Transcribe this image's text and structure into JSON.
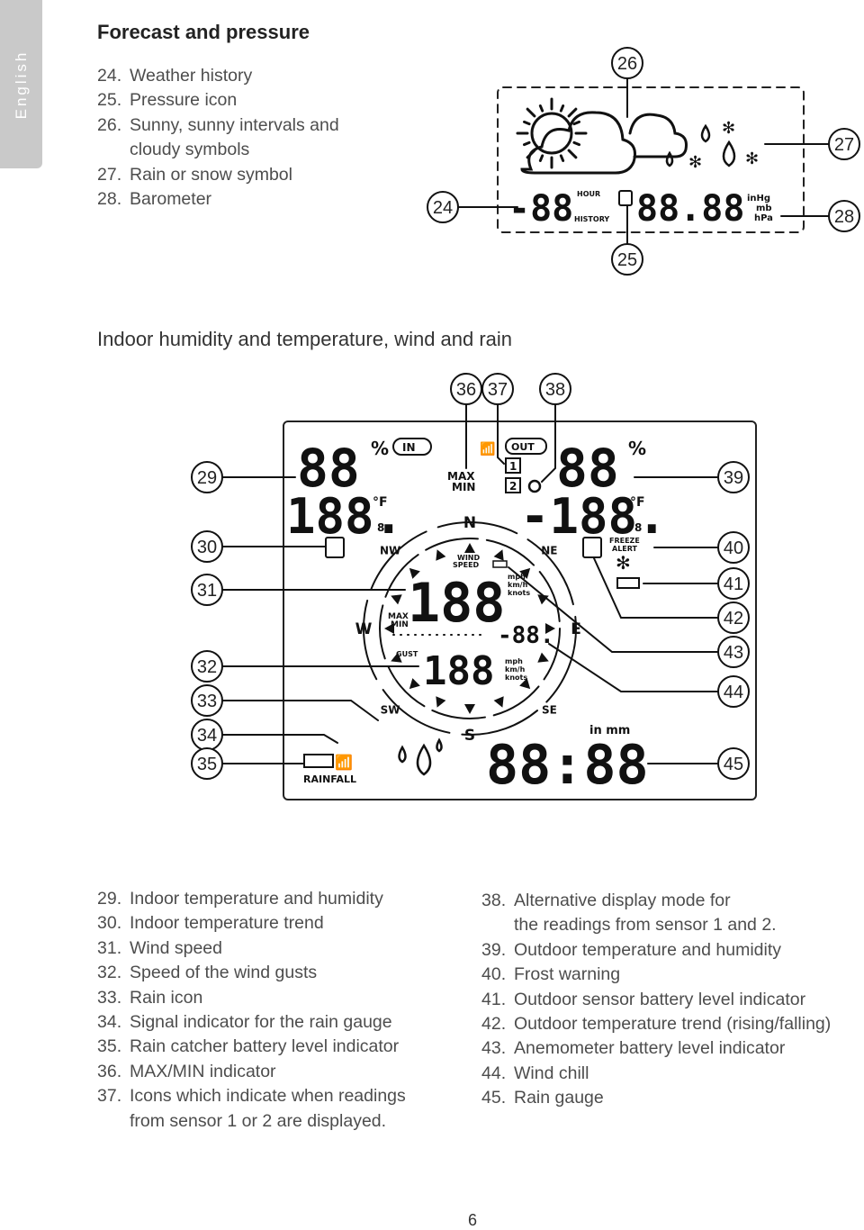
{
  "side_tab": {
    "label": "English"
  },
  "section1": {
    "title": "Forecast and pressure",
    "items": [
      {
        "num": "24.",
        "text": "Weather history"
      },
      {
        "num": "25.",
        "text": "Pressure icon"
      },
      {
        "num": "26.",
        "text": "Sunny, sunny intervals and",
        "cont": "cloudy symbols"
      },
      {
        "num": "27.",
        "text": "Rain or snow symbol"
      },
      {
        "num": "28.",
        "text": "Barometer"
      }
    ],
    "diagram": {
      "callouts": [
        "24",
        "25",
        "26",
        "27",
        "28"
      ],
      "history_digits": "-88",
      "hour": "HOUR",
      "history": "HISTORY",
      "pressure_digits": "88.88",
      "units": [
        "inHg",
        "mb",
        "hPa"
      ]
    }
  },
  "section2": {
    "title": "Indoor humidity and temperature, wind and rain",
    "diagram": {
      "callouts_left": [
        "29",
        "30",
        "31",
        "32",
        "33",
        "34",
        "35"
      ],
      "callouts_right": [
        "39",
        "40",
        "41",
        "42",
        "43",
        "44",
        "45"
      ],
      "callouts_top": [
        "36",
        "37",
        "38"
      ],
      "in_humidity": "88",
      "percent": "%",
      "in": "IN",
      "in_temp": "188.",
      "deg": "°F",
      "decimal": "8",
      "out": "OUT",
      "out_humidity": "88",
      "out_temp": "-188.",
      "max": "MAX",
      "min": "MIN",
      "sensor1": "1",
      "sensor2": "2",
      "compass": [
        "N",
        "NE",
        "E",
        "SE",
        "S",
        "SW",
        "W",
        "NW"
      ],
      "wind": "WIND",
      "speed": "SPEED",
      "wind_digits": "188",
      "gust": "GUST",
      "gust_digits": "188",
      "units": [
        "mph",
        "km/h",
        "knots"
      ],
      "chill_digits": "-88.",
      "freeze": "FREEZE",
      "alert": "ALERT",
      "rainfall": "RAINFALL",
      "rain_units": "in mm",
      "rain_digits": "88:88"
    }
  },
  "list_left": [
    {
      "num": "29.",
      "text": "Indoor temperature and humidity"
    },
    {
      "num": "30.",
      "text": "Indoor temperature trend"
    },
    {
      "num": "31.",
      "text": "Wind speed"
    },
    {
      "num": "32.",
      "text": "Speed of the wind gusts"
    },
    {
      "num": "33.",
      "text": "Rain icon"
    },
    {
      "num": "34.",
      "text": "Signal indicator for the rain gauge"
    },
    {
      "num": "35.",
      "text": "Rain catcher battery level indicator"
    },
    {
      "num": "36.",
      "text": "MAX/MIN indicator"
    },
    {
      "num": "37.",
      "text": "Icons which indicate when readings",
      "cont": "from sensor 1 or 2 are displayed."
    }
  ],
  "list_right": [
    {
      "num": "38.",
      "text": "Alternative display mode for",
      "cont": "the readings from sensor 1 and 2."
    },
    {
      "num": "39.",
      "text": "Outdoor temperature and humidity"
    },
    {
      "num": "40.",
      "text": "Frost warning"
    },
    {
      "num": "41.",
      "text": "Outdoor sensor battery level indicator"
    },
    {
      "num": "42.",
      "text": "Outdoor temperature trend (rising/falling)"
    },
    {
      "num": "43.",
      "text": "Anemometer battery level indicator"
    },
    {
      "num": "44.",
      "text": "Wind chill"
    },
    {
      "num": "45.",
      "text": "Rain gauge"
    }
  ],
  "page_number": "6"
}
